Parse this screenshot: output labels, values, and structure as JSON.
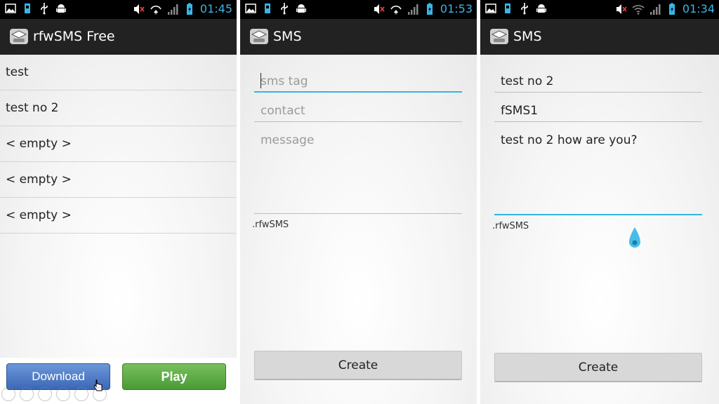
{
  "screens": [
    {
      "status_time": "01:45",
      "title": "rfwSMS Free",
      "list": [
        "test",
        "test no 2",
        "< empty >",
        "< empty >",
        "< empty >"
      ],
      "buttons": {
        "download": "Download",
        "play": "Play"
      }
    },
    {
      "status_time": "01:53",
      "title": "SMS",
      "fields": {
        "tag_placeholder": "sms tag",
        "contact_placeholder": "contact",
        "message_placeholder": "message"
      },
      "suffix_label": ".rfwSMS",
      "create_label": "Create"
    },
    {
      "status_time": "01:34",
      "title": "SMS",
      "fields": {
        "tag_value": "test no 2",
        "contact_value": "fSMS1",
        "message_value": "test no 2 how are you?"
      },
      "suffix_label": ".rfwSMS",
      "create_label": "Create"
    }
  ],
  "colors": {
    "status_accent": "#38b6e8",
    "action_bar": "#222222",
    "focus_underline": "#33b5e5",
    "download_button": "#3a67b6",
    "play_button": "#4a9a35"
  },
  "icons": {
    "status_left": [
      "gallery-icon",
      "sd-card-icon",
      "usb-icon",
      "android-debug-icon"
    ],
    "status_right": [
      "volume-muted-icon",
      "data-arrows-icon",
      "signal-icon",
      "battery-charging-icon"
    ],
    "app": "app-logo-icon"
  }
}
